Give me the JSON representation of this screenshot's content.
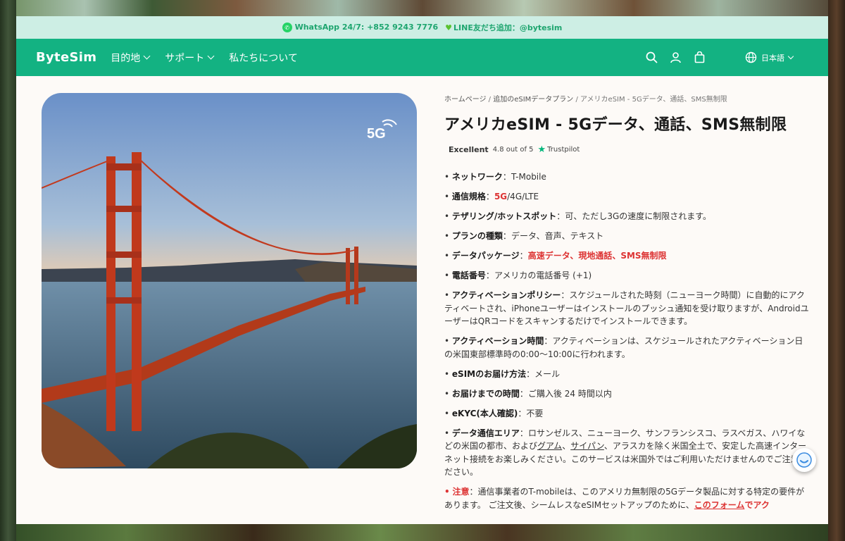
{
  "announcement": {
    "whatsapp": "WhatsApp 24/7: +852 9243 7776",
    "line": "LINE友だち追加：@bytesim"
  },
  "nav": {
    "logo": "ByteSim",
    "items": [
      "目的地",
      "サポート",
      "私たちについて"
    ],
    "language": "日本語"
  },
  "breadcrumb": {
    "home": "ホームページ",
    "parent": "追加のeSIMデータプラン",
    "current": "アメリカeSIM - 5Gデータ、通話、SMS無制限"
  },
  "product": {
    "title": "アメリカeSIM - 5Gデータ、通話、SMS無制限",
    "badge": "5G",
    "trustpilot": {
      "label": "Excellent",
      "score": "4.8 out of 5",
      "brand": "Trustpilot"
    },
    "specs": {
      "network_label": "ネットワーク",
      "network_value": "T-Mobile",
      "standard_label": "通信規格",
      "standard_5g": "5G",
      "standard_rest": "/4G/LTE",
      "tethering_label": "テザリング/ホットスポット",
      "tethering_value": "可、ただし3Gの速度に制限されます。",
      "plan_label": "プランの種類",
      "plan_value": "データ、音声、テキスト",
      "package_label": "データパッケージ",
      "package_value": "高速データ、現地通話、SMS無制限",
      "phone_label": "電話番号",
      "phone_value": "アメリカの電話番号 (+1)",
      "policy_label": "アクティベーションポリシー",
      "policy_value": "スケジュールされた時刻（ニューヨーク時間）に自動的にアクティベートされ、iPhoneユーザーはインストールのプッシュ通知を受け取りますが、AndroidユーザーはQRコードをスキャンするだけでインストールできます。",
      "time_label": "アクティベーション時間",
      "time_value": "アクティベーションは、スケジュールされたアクティベーション日の米国東部標準時の0:00〜10:00に行われます。",
      "delivery_label": "eSIMのお届け方法",
      "delivery_value": "メール",
      "lead_label": "お届けまでの時間",
      "lead_value": "ご購入後 24 時間以内",
      "ekyc_label": "eKYC(本人確認)",
      "ekyc_value": "不要",
      "area_label": "データ通信エリア",
      "area_value_1": "ロサンゼルス、ニューヨーク、サンフランシスコ、ラスベガス、ハワイなどの米国の都市、および",
      "area_link_guam": "グアム",
      "area_sep": "、",
      "area_link_saipan": "サイパン",
      "area_value_2": "、アラスカを除く米国全土で、安定した高速インターネット接続をお楽しみください。このサービスは米国外ではご利用いただけませんのでご注意ください。",
      "note_label": "注意",
      "note_value_1": "：通信事業者のT-mobileは、このアメリカ無制限の5Gデータ製品に対する特定の要件があります。 ご注文後、シームレスなeSIMセットアップのために、",
      "note_link": "このフォーム",
      "note_value_2": "でアク"
    }
  }
}
